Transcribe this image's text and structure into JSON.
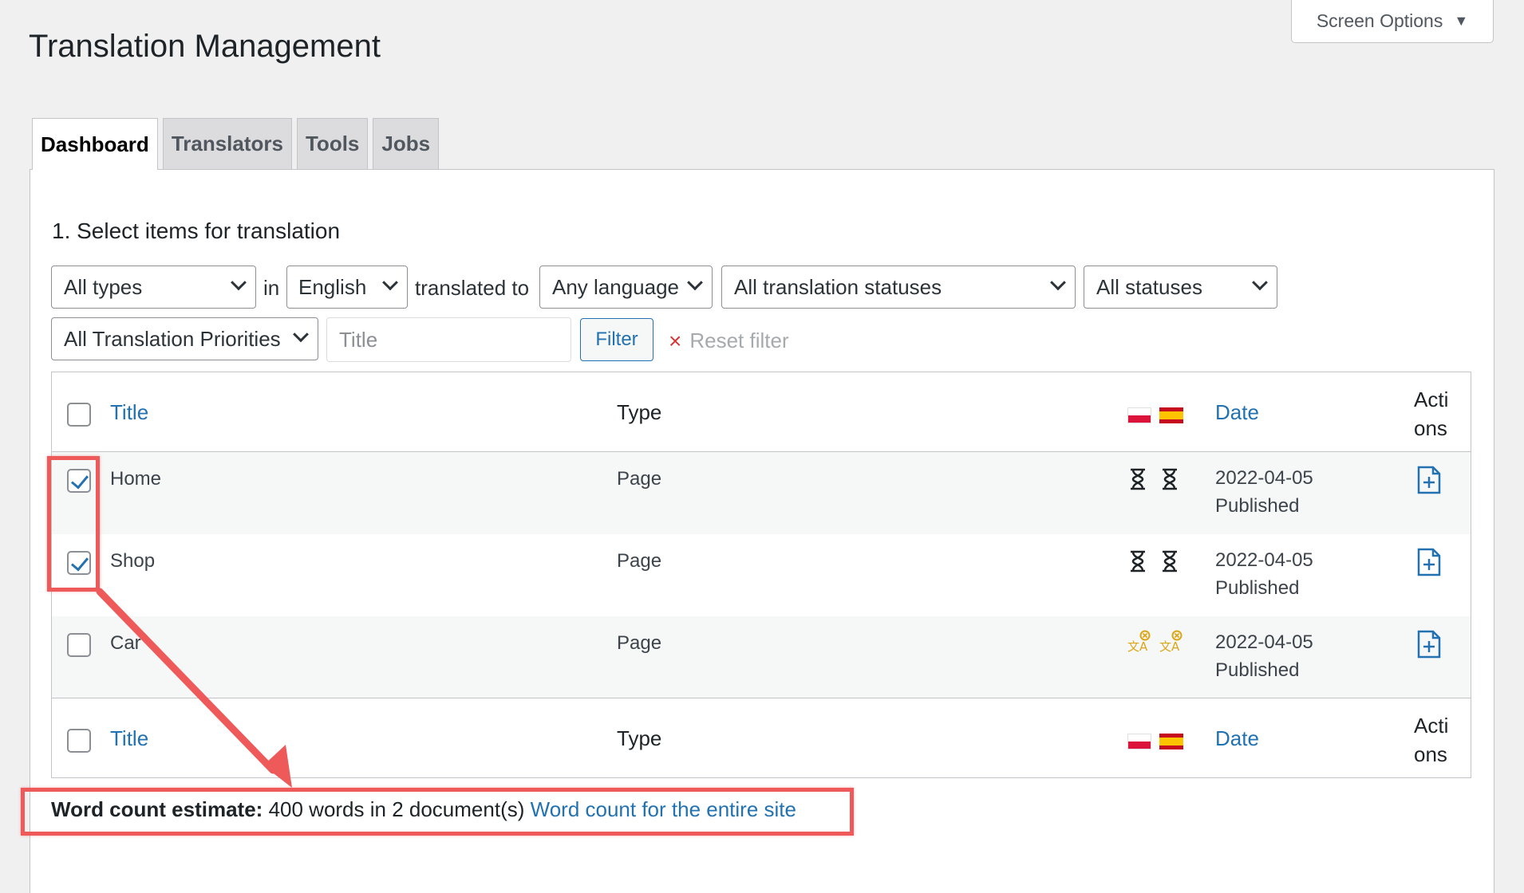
{
  "header": {
    "screen_options": "Screen Options",
    "page_title": "Translation Management"
  },
  "tabs": [
    {
      "label": "Dashboard",
      "active": true
    },
    {
      "label": "Translators",
      "active": false
    },
    {
      "label": "Tools",
      "active": false
    },
    {
      "label": "Jobs",
      "active": false
    }
  ],
  "filters": {
    "section_title": "1. Select items for translation",
    "type_select": "All types",
    "in_label": "in",
    "source_language_select": "English",
    "translated_to_label": "translated to",
    "target_language_select": "Any language",
    "translation_status_select": "All translation statuses",
    "status_select": "All statuses",
    "priority_select": "All Translation Priorities",
    "title_placeholder": "Title",
    "filter_button": "Filter",
    "reset_filter": "Reset filter"
  },
  "table": {
    "columns": {
      "title": "Title",
      "type": "Type",
      "languages": [
        "pl",
        "es"
      ],
      "date": "Date",
      "actions": "Acti ons"
    },
    "rows": [
      {
        "title": "Home",
        "type": "Page",
        "checked": true,
        "status_icon": "hourglass-icon",
        "date": "2022-04-05",
        "status": "Published"
      },
      {
        "title": "Shop",
        "type": "Page",
        "checked": true,
        "status_icon": "hourglass-icon",
        "date": "2022-04-05",
        "status": "Published"
      },
      {
        "title": "Car",
        "type": "Page",
        "checked": false,
        "status_icon": "needs-translation-icon",
        "date": "2022-04-05",
        "status": "Published"
      }
    ]
  },
  "word_count": {
    "label": "Word count estimate:",
    "value": "400 words in 2 document(s)",
    "link": "Word count for the entire site"
  },
  "colors": {
    "link": "#2271b1",
    "annotation": "#ee5a5a",
    "warning_icon": "#dba617"
  }
}
